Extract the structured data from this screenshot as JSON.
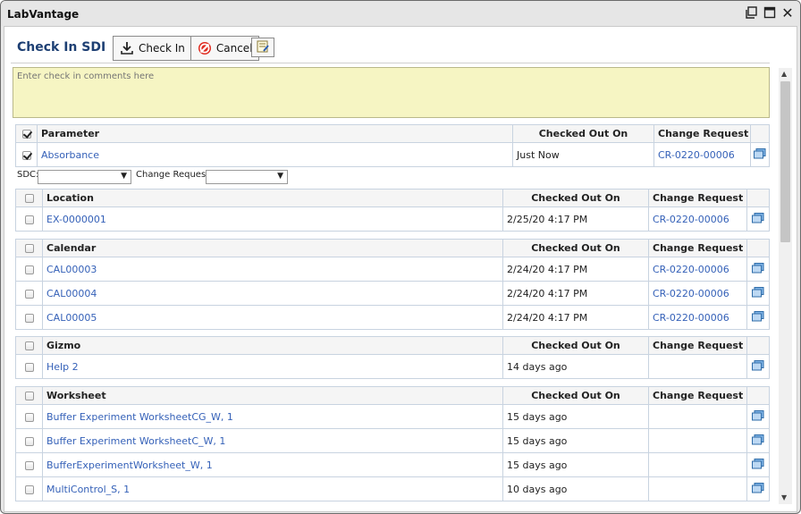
{
  "window": {
    "title": "LabVantage"
  },
  "header": {
    "title": "Check In SDI",
    "checkin_label": "Check In",
    "cancel_label": "Cancel"
  },
  "comments": {
    "placeholder": "Enter check in comments here"
  },
  "filters": {
    "sdc_label": "SDC:",
    "change_request_label": "Change Request:"
  },
  "parameter_table": {
    "headers": [
      "Parameter",
      "Checked Out On",
      "Change Request"
    ],
    "rows": [
      {
        "name": "Absorbance",
        "checked_out_on": "Just Now",
        "change_request": "CR-0220-00006"
      }
    ]
  },
  "location_table": {
    "headers": [
      "Location",
      "Checked Out On",
      "Change Request"
    ],
    "rows": [
      {
        "name": "EX-0000001",
        "checked_out_on": "2/25/20 4:17 PM",
        "change_request": "CR-0220-00006"
      }
    ]
  },
  "calendar_table": {
    "headers": [
      "Calendar",
      "Checked Out On",
      "Change Request"
    ],
    "rows": [
      {
        "name": "CAL00003",
        "checked_out_on": "2/24/20 4:17 PM",
        "change_request": "CR-0220-00006"
      },
      {
        "name": "CAL00004",
        "checked_out_on": "2/24/20 4:17 PM",
        "change_request": "CR-0220-00006"
      },
      {
        "name": "CAL00005",
        "checked_out_on": "2/24/20 4:17 PM",
        "change_request": "CR-0220-00006"
      }
    ]
  },
  "gizmo_table": {
    "headers": [
      "Gizmo",
      "Checked Out On",
      "Change Request"
    ],
    "rows": [
      {
        "name": "Help 2",
        "checked_out_on": "14 days ago",
        "change_request": ""
      }
    ]
  },
  "worksheet_table": {
    "headers": [
      "Worksheet",
      "Checked Out On",
      "Change Request"
    ],
    "rows": [
      {
        "name": "Buffer Experiment WorksheetCG_W, 1",
        "checked_out_on": "15 days ago",
        "change_request": ""
      },
      {
        "name": "Buffer Experiment WorksheetC_W, 1",
        "checked_out_on": "15 days ago",
        "change_request": ""
      },
      {
        "name": "BufferExperimentWorksheet_W, 1",
        "checked_out_on": "15 days ago",
        "change_request": ""
      },
      {
        "name": "MultiControl_S, 1",
        "checked_out_on": "10 days ago",
        "change_request": ""
      }
    ]
  },
  "icons": {
    "history": "history-icon",
    "checkin": "checkin-icon",
    "cancel": "cancel-icon",
    "note": "note-icon"
  },
  "colors": {
    "link": "#3561b8",
    "heading": "#1d3f73",
    "comment_bg": "#f6f5c3"
  }
}
